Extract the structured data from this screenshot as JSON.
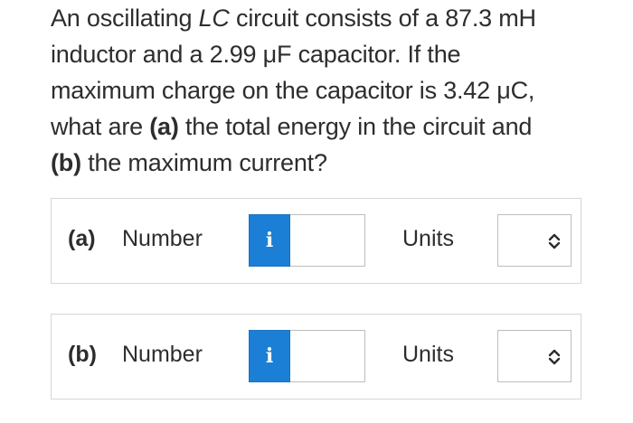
{
  "question": {
    "line1_pre": "An oscillating ",
    "line1_italic": "LC",
    "line1_post": " circuit consists of a 87.3 mH",
    "line2": "inductor and a 2.99 μF capacitor. If the",
    "line3": "maximum charge on the capacitor is 3.42 μC,",
    "line4_pre": "what are ",
    "line4_bold": "(a)",
    "line4_post": " the total energy in the circuit and",
    "line5_bold": "(b)",
    "line5_post": " the maximum current?"
  },
  "parts": [
    {
      "label": "(a)",
      "number_label": "Number",
      "info_glyph": "i",
      "number_value": "",
      "units_label": "Units",
      "units_selected": ""
    },
    {
      "label": "(b)",
      "number_label": "Number",
      "info_glyph": "i",
      "number_value": "",
      "units_label": "Units",
      "units_selected": ""
    }
  ],
  "colors": {
    "info_button": "#1c7fd6",
    "text": "#2d2d2d",
    "border": "#d6d6d6"
  },
  "icons": {
    "info": "info-icon",
    "select": "chevron-up-down-icon"
  }
}
